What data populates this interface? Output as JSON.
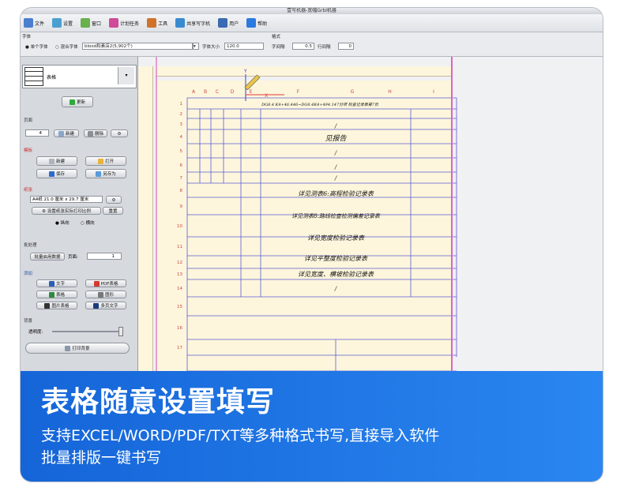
{
  "window": {
    "title": "壹写机器-宽幅Grbl机器"
  },
  "menu": [
    {
      "label": "文件",
      "icon": "file-icon",
      "color": "#4a7fd0"
    },
    {
      "label": "设置",
      "icon": "gear-icon",
      "color": "#4aa0d0"
    },
    {
      "label": "窗口",
      "icon": "window-icon",
      "color": "#6ab04c"
    },
    {
      "label": "计划任务",
      "icon": "task-icon",
      "color": "#d04a9a"
    },
    {
      "label": "工具",
      "icon": "pen-icon",
      "color": "#d0722a"
    },
    {
      "label": "共享写字机",
      "icon": "share-icon",
      "color": "#3a8ad0"
    },
    {
      "label": "用户",
      "icon": "user-icon",
      "color": "#3a6ab0"
    },
    {
      "label": "帮助",
      "icon": "help-icon",
      "color": "#2a7ae0"
    }
  ],
  "fontbar": {
    "font_label": "字体",
    "single_font": "单个字体",
    "mixed_font": "混合字体",
    "font_value": "blood和素店2(5,902个)",
    "font_size_label": "字体大小",
    "font_size_value": "120.0",
    "format_label": "格式",
    "char_spacing_label": "字间隔",
    "char_spacing_value": "0.5",
    "line_spacing_label": "行间隔",
    "line_spacing_value": "0"
  },
  "sidebar": {
    "template_name": "表格",
    "update_btn": "更新",
    "page_label": "页面",
    "page_value": "4",
    "new_btn": "新建",
    "delete_btn": "删除",
    "template_label": "模板",
    "tpl_new": "新建",
    "tpl_open": "打开",
    "tpl_save": "保存",
    "tpl_saveas": "另存为",
    "paper_label": "纸张",
    "paper_value": "A4纸 21.0 厘米 x 29.7 厘米",
    "set_paper_btn": "设置纸张实际打印比例",
    "reset_btn": "重置",
    "portrait": "纵向",
    "landscape": "横向",
    "batch_label": "批处理",
    "batch_btn": "批量启用数据",
    "page_field_label": "页面:",
    "page_field_value": "1",
    "add_label": "添加",
    "add_text": "文字",
    "add_pdf": "PDF表格",
    "add_table": "表格",
    "add_image": "图形",
    "add_img_table": "图片表格",
    "add_multi": "多页文字",
    "bg_label": "背景",
    "transparency_label": "透明度:",
    "print_bg_btn": "打印背景"
  },
  "columns": [
    "A",
    "B",
    "C",
    "D",
    "E",
    "F",
    "G",
    "H",
    "I"
  ],
  "rows": [
    "1",
    "2",
    "3",
    "4",
    "5",
    "6",
    "7",
    "8",
    "9",
    "10",
    "11",
    "12",
    "13",
    "14",
    "15",
    "16",
    "17"
  ],
  "axis": {
    "x": "X",
    "y": "Y"
  },
  "cells": {
    "r2": "DG8.4  K4+46.446~DG8.4K4+494.147分项  检查记录表第7页",
    "c1": "/",
    "c2": "见报告",
    "c3": "/",
    "c4": "/",
    "c5": "/",
    "c6": "详见测表6:高程检验记录表",
    "c7": "详见测表8:路线检查检测偏差记录表",
    "c8": "详见宽度检验记录表",
    "c9": "详见平整度检验记录表",
    "c10": "详见宽度、横坡检验记录表",
    "c11": "/"
  },
  "banner": {
    "title": "表格随意设置填写",
    "line1": "支持EXCEL/WORD/PDF/TXT等多种格式书写,直接导入软件",
    "line2": "批量排版一键书写"
  }
}
